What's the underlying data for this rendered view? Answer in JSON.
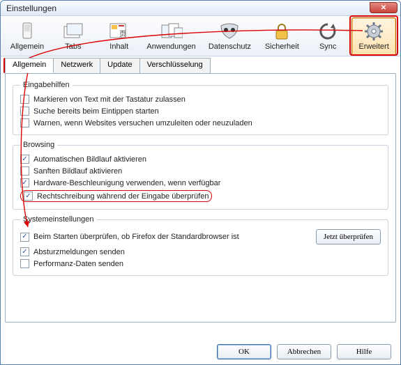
{
  "window": {
    "title": "Einstellungen",
    "close_label": "✕"
  },
  "toolbar": {
    "items": [
      {
        "label": "Allgemein"
      },
      {
        "label": "Tabs"
      },
      {
        "label": "Inhalt"
      },
      {
        "label": "Anwendungen"
      },
      {
        "label": "Datenschutz"
      },
      {
        "label": "Sicherheit"
      },
      {
        "label": "Sync"
      },
      {
        "label": "Erweitert"
      }
    ]
  },
  "tabs": {
    "items": [
      {
        "label": "Allgemein"
      },
      {
        "label": "Netzwerk"
      },
      {
        "label": "Update"
      },
      {
        "label": "Verschlüsselung"
      }
    ]
  },
  "groups": {
    "eingabehilfen": {
      "legend": "Eingabehilfen",
      "items": [
        {
          "checked": false,
          "label": "Markieren von Text mit der Tastatur zulassen"
        },
        {
          "checked": false,
          "label": "Suche bereits beim Eintippen starten"
        },
        {
          "checked": false,
          "label": "Warnen, wenn Websites versuchen umzuleiten oder neuzuladen"
        }
      ]
    },
    "browsing": {
      "legend": "Browsing",
      "items": [
        {
          "checked": true,
          "label": "Automatischen Bildlauf aktivieren"
        },
        {
          "checked": false,
          "label": "Sanften Bildlauf aktivieren"
        },
        {
          "checked": true,
          "label": "Hardware-Beschleunigung verwenden, wenn verfügbar"
        },
        {
          "checked": true,
          "label": "Rechtschreibung während der Eingabe überprüfen"
        }
      ]
    },
    "system": {
      "legend": "Systemeinstellungen",
      "items": [
        {
          "checked": true,
          "label": "Beim Starten überprüfen, ob Firefox der Standardbrowser ist"
        },
        {
          "checked": true,
          "label": "Absturzmeldungen senden"
        },
        {
          "checked": false,
          "label": "Performanz-Daten senden"
        }
      ],
      "check_now": "Jetzt überprüfen"
    }
  },
  "footer": {
    "ok": "OK",
    "cancel": "Abbrechen",
    "help": "Hilfe"
  }
}
